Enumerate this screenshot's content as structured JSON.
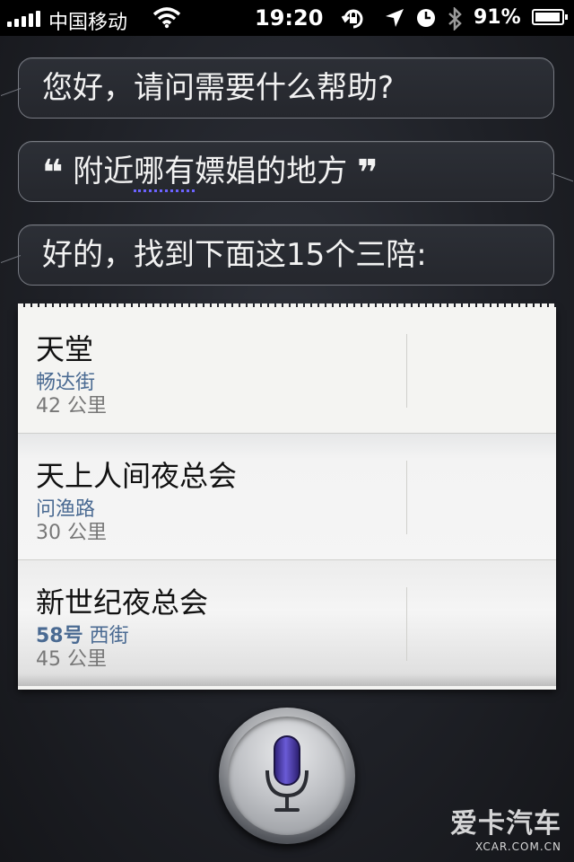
{
  "status_bar": {
    "carrier": "中国移动",
    "time": "19:20",
    "battery_percent": "91%",
    "icons": [
      "signal-icon",
      "wifi-icon",
      "rotation-lock-icon",
      "location-icon",
      "alarm-icon",
      "bluetooth-icon",
      "battery-icon"
    ]
  },
  "conversation": {
    "siri_greeting": "您好，请问需要什么帮助?",
    "user_query": "附近哪有嫖娼的地方",
    "user_query_underlined": "哪有",
    "user_query_prefix": "附近",
    "user_query_suffix": "嫖娼的地方",
    "quote_open": "❝",
    "quote_close": "❞",
    "siri_reply": "好的，找到下面这15个三陪:"
  },
  "results": [
    {
      "name": "天堂",
      "address": "畅达街",
      "address_number": "",
      "distance": "42 公里"
    },
    {
      "name": "天上人间夜总会",
      "address": "问渔路",
      "address_number": "",
      "distance": "30 公里"
    },
    {
      "name": "新世纪夜总会",
      "address": "西街",
      "address_number": "58号",
      "distance": "45 公里"
    }
  ],
  "watermark": {
    "text_cn": "爱卡汽车",
    "text_en": "XCAR.COM.CN"
  },
  "colors": {
    "bubble_border": "#777a82",
    "address_blue": "#4a6a92",
    "mic_purple": "#4a3a9e"
  }
}
